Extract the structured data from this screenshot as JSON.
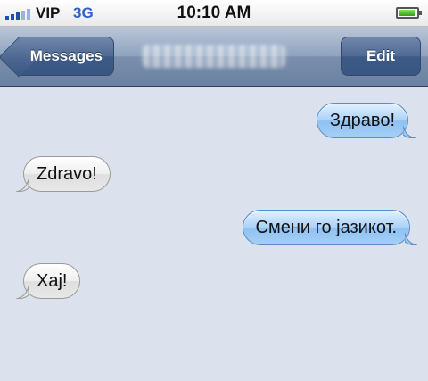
{
  "status_bar": {
    "carrier": "VIP",
    "network": "3G",
    "time": "10:10 AM"
  },
  "nav": {
    "back_label": "Messages",
    "contact": "",
    "edit_label": "Edit"
  },
  "messages": [
    {
      "direction": "outgoing",
      "text": "Здраво!"
    },
    {
      "direction": "incoming",
      "text": "Zdravo!"
    },
    {
      "direction": "outgoing",
      "text": "Смени го јазикот."
    },
    {
      "direction": "incoming",
      "text": "Хај!"
    }
  ],
  "colors": {
    "outgoing_bubble": "#a9d1f7",
    "incoming_bubble": "#eeeeee",
    "nav_bar": "#6b81a1",
    "background": "#dbe2ed"
  }
}
